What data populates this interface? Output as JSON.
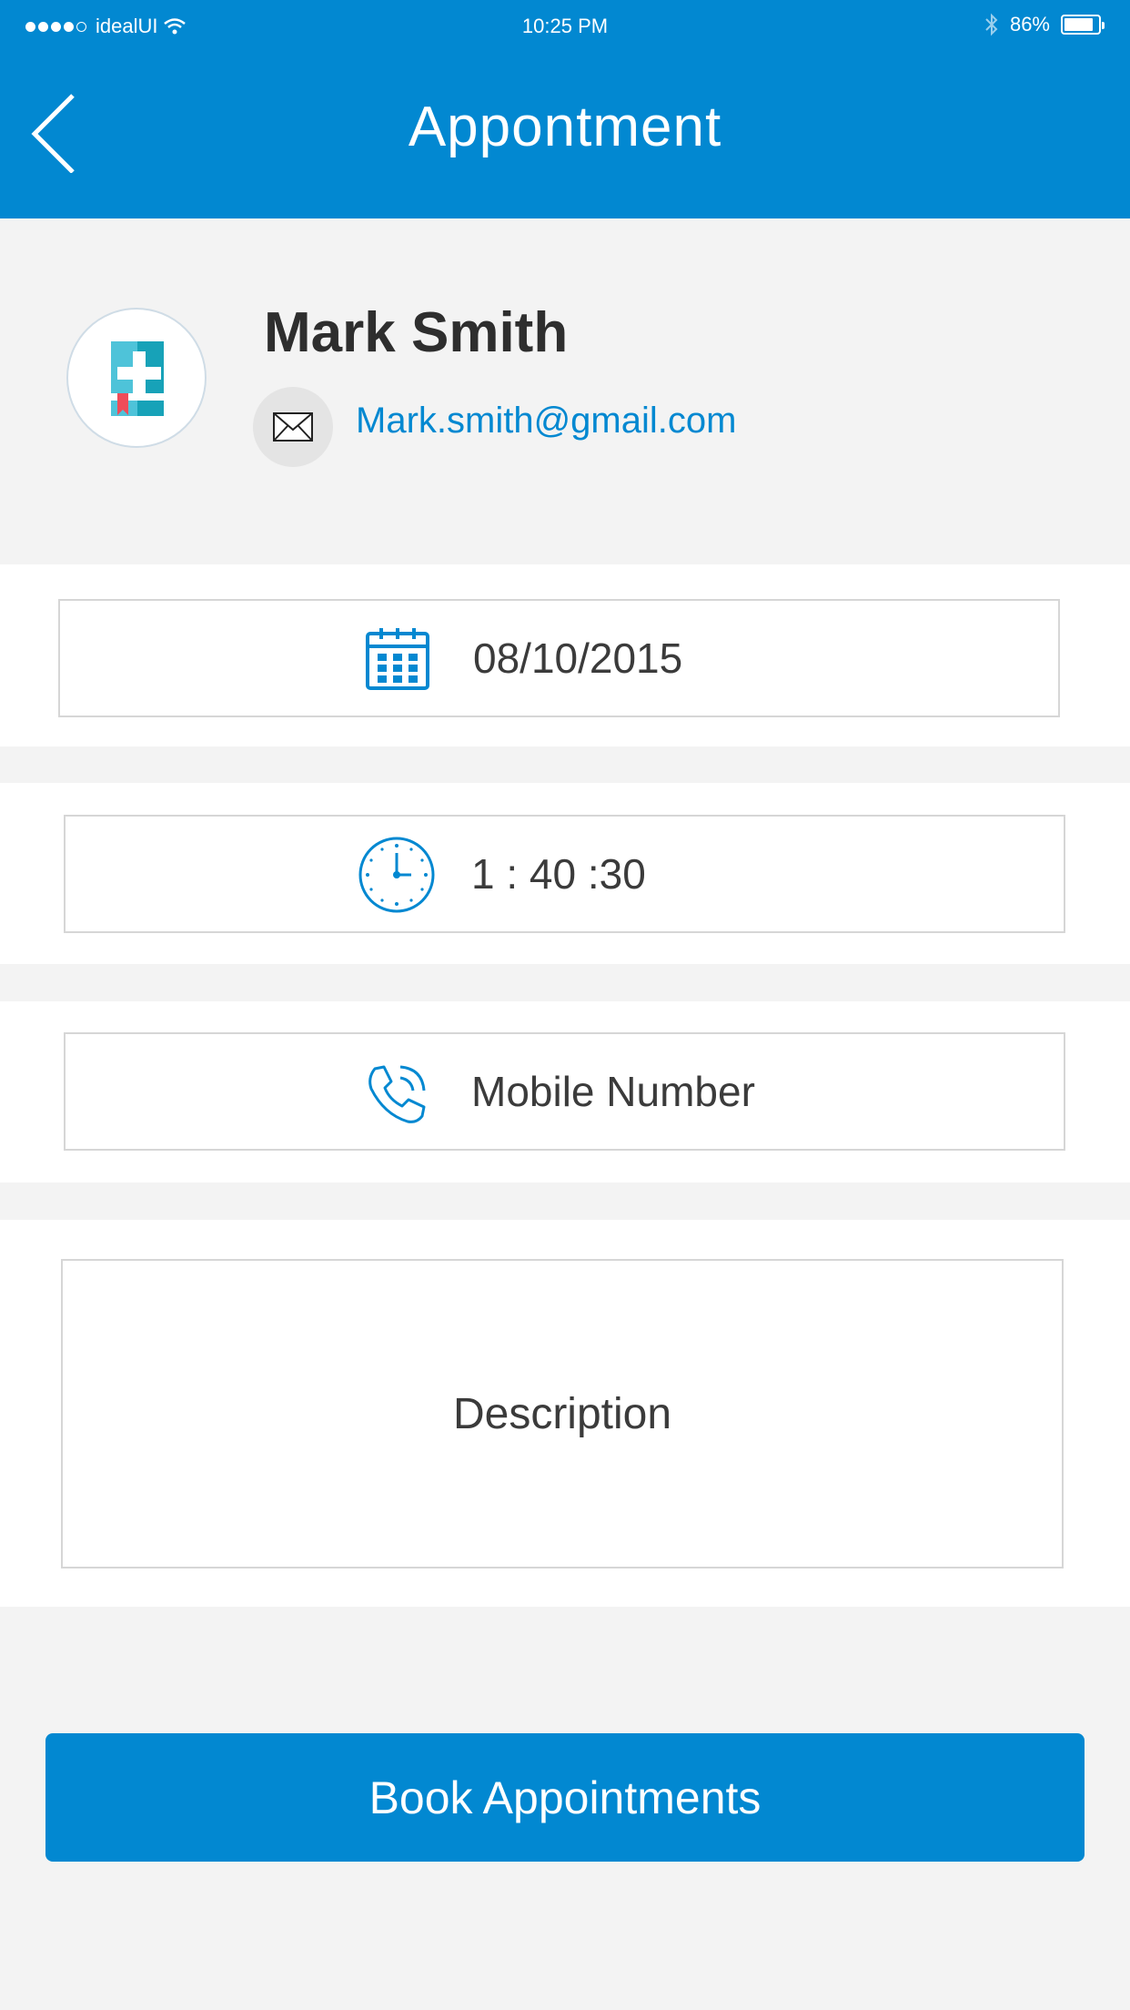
{
  "status_bar": {
    "carrier": "idealUI",
    "time": "10:25 PM",
    "battery": "86%"
  },
  "header": {
    "title": "Appontment"
  },
  "profile": {
    "name": "Mark Smith",
    "email": "Mark.smith@gmail.com"
  },
  "form": {
    "date_value": "08/10/2015",
    "time_value": "1 : 40 :30",
    "mobile_placeholder": "Mobile Number",
    "description_placeholder": "Description"
  },
  "actions": {
    "book_label": "Book Appointments"
  },
  "colors": {
    "primary": "#0288d1",
    "background": "#f3f3f3",
    "text": "#3b3b3b"
  },
  "icons": [
    "back-chevron-icon",
    "wifi-icon",
    "bluetooth-icon",
    "battery-icon",
    "medical-book-icon",
    "mail-icon",
    "calendar-icon",
    "clock-icon",
    "phone-icon"
  ]
}
